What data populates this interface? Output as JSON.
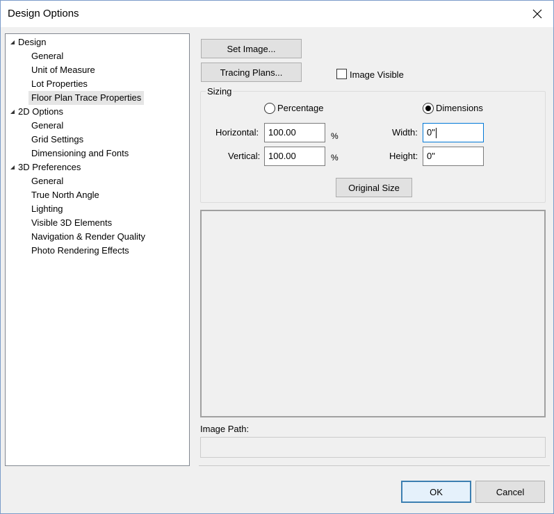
{
  "window": {
    "title": "Design Options"
  },
  "tree": {
    "items": [
      {
        "label": "Design",
        "level": 0,
        "expanded": true
      },
      {
        "label": "General",
        "level": 1
      },
      {
        "label": "Unit of Measure",
        "level": 1
      },
      {
        "label": "Lot Properties",
        "level": 1
      },
      {
        "label": "Floor Plan Trace Properties",
        "level": 1,
        "selected": true
      },
      {
        "label": "2D Options",
        "level": 0,
        "expanded": true
      },
      {
        "label": "General",
        "level": 1
      },
      {
        "label": "Grid Settings",
        "level": 1
      },
      {
        "label": "Dimensioning and Fonts",
        "level": 1
      },
      {
        "label": "3D Preferences",
        "level": 0,
        "expanded": true
      },
      {
        "label": "General",
        "level": 1
      },
      {
        "label": "True North Angle",
        "level": 1
      },
      {
        "label": "Lighting",
        "level": 1
      },
      {
        "label": "Visible 3D Elements",
        "level": 1
      },
      {
        "label": "Navigation & Render Quality",
        "level": 1
      },
      {
        "label": "Photo Rendering Effects",
        "level": 1
      }
    ]
  },
  "panel": {
    "set_image_label": "Set Image...",
    "tracing_plans_label": "Tracing Plans...",
    "image_visible_label": "Image Visible",
    "image_visible_checked": false,
    "sizing": {
      "title": "Sizing",
      "percentage_label": "Percentage",
      "percentage_selected": false,
      "dimensions_label": "Dimensions",
      "dimensions_selected": true,
      "horizontal_label": "Horizontal:",
      "horizontal_value": "100.00",
      "horizontal_unit": "%",
      "vertical_label": "Vertical:",
      "vertical_value": "100.00",
      "vertical_unit": "%",
      "width_label": "Width:",
      "width_value": "0\"",
      "height_label": "Height:",
      "height_value": "0\"",
      "original_size_label": "Original Size"
    },
    "image_path_label": "Image Path:",
    "image_path_value": ""
  },
  "footer": {
    "ok_label": "OK",
    "cancel_label": "Cancel"
  },
  "colors": {
    "selection": "#e5e5e5",
    "focus": "#0078d7",
    "default_button": "#3c7fb1"
  }
}
